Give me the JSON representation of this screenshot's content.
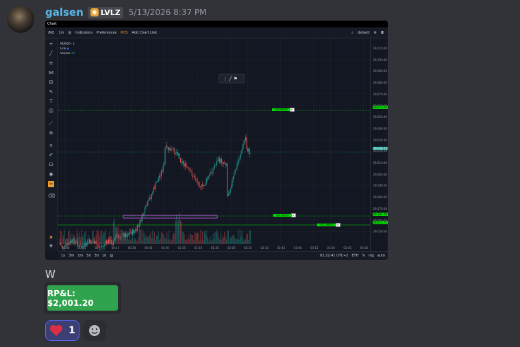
{
  "message": {
    "author": "galsen",
    "tag": "LVLZ",
    "timestamp": "5/13/2026 8:37 PM",
    "text": "W",
    "embed_label": "RP&L: $2,001.20",
    "embed_color": "#2fa34d"
  },
  "reactions": [
    {
      "emoji": "heart-icon",
      "count": "1"
    }
  ],
  "chart": {
    "window_title": "Chart",
    "symbol": "/NQ",
    "interval": "1m",
    "indicators_label": "Indicators",
    "preferences_label": "Preferences",
    "pos_label": "POS",
    "add_link_label": "Add Chart Link",
    "layout_label": "default",
    "legend_symbol": "NQM26 · 1",
    "legend_link": "Link",
    "legend_volume": "Volume",
    "legend_volume_value": "14",
    "ranges": [
      "1y",
      "3m",
      "1m",
      "5d",
      "3d",
      "1d"
    ],
    "clock": "02:22:41 UTC+2",
    "session": "ETH",
    "scale_opts": [
      "%",
      "log",
      "auto"
    ],
    "price_ticks": [
      "29,710.00",
      "29,700.00",
      "29,690.00",
      "29,680.00",
      "29,670.00",
      "29,660.00",
      "29,650.00",
      "29,640.00",
      "29,630.00",
      "29,620.00",
      "29,610.00",
      "29,600.00",
      "29,590.00",
      "29,580.00",
      "29,570.00",
      "29,560.00",
      "29,550.00"
    ],
    "time_ticks": [
      "23:30",
      "23:45",
      "00",
      "00:15",
      "00:30",
      "00:45",
      "01:00",
      "01:15",
      "01:30",
      "01:45",
      "02:00",
      "02:15",
      "02:30",
      "02:45",
      "03:00",
      "03:15",
      "03:30",
      "03:45",
      "04:00"
    ],
    "orders": [
      {
        "label": "+$2065.00",
        "price_label": "29,674.00"
      },
      {
        "label": "+$1159.00",
        "price_label": "29,581.00"
      },
      {
        "label": "+$1,098.00",
        "price_label": "29,572.75"
      }
    ],
    "last_price_label": "29,636.25",
    "colors": {
      "up": "#26a69a",
      "down": "#ef5350",
      "order": "#00e000",
      "box": "#b04ad6"
    }
  }
}
